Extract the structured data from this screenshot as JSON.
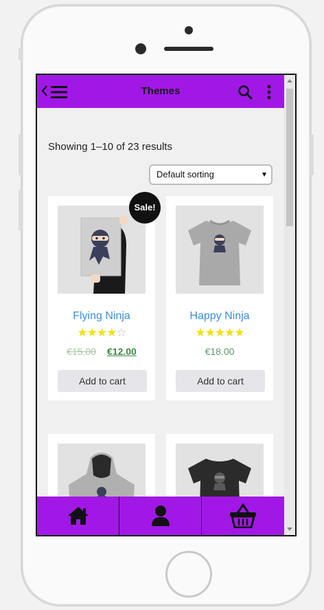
{
  "app": {
    "title": "Themes"
  },
  "listing": {
    "results_text": "Showing 1–10 of 23 results",
    "sorting": {
      "selected": "Default sorting"
    }
  },
  "products": [
    {
      "name": "Flying Ninja",
      "rating": 4,
      "rating_max": 5,
      "old_price": "€15.00",
      "price": "€12.00",
      "sale_badge": "Sale!",
      "button": "Add to cart",
      "image": "ninja-poster"
    },
    {
      "name": "Happy Ninja",
      "rating": 5,
      "rating_max": 5,
      "price": "€18.00",
      "button": "Add to cart",
      "image": "ninja-tshirt-grey"
    },
    {
      "image": "ninja-hoodie-grey"
    },
    {
      "image": "ninja-tshirt-black"
    }
  ],
  "bottom_nav": [
    {
      "icon": "home-icon"
    },
    {
      "icon": "user-icon"
    },
    {
      "icon": "basket-icon"
    }
  ],
  "colors": {
    "accent": "#a118e6",
    "link": "#3a8fdf",
    "star": "#f2e20f",
    "price": "#3f8a41"
  }
}
